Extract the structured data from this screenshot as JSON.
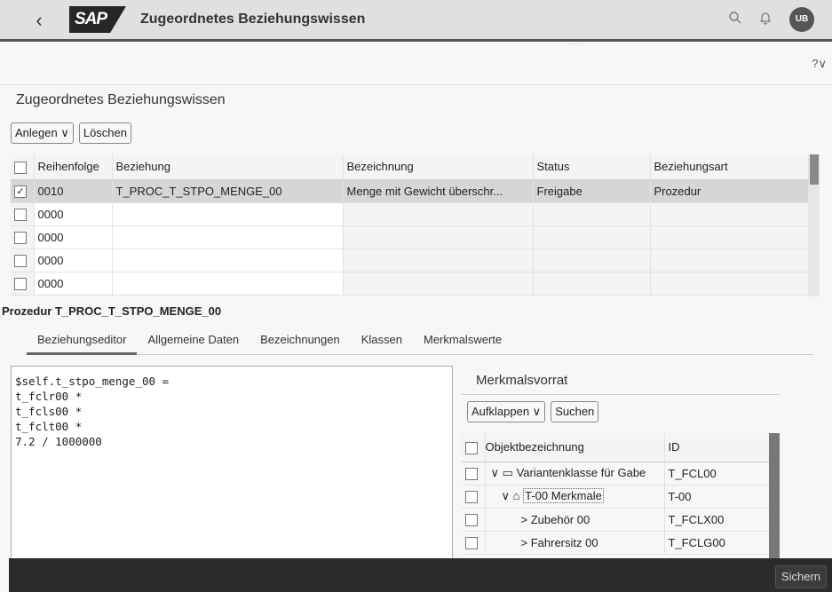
{
  "shell": {
    "logo": "SAP",
    "title": "Zugeordnetes Beziehungswissen",
    "avatar": "UB"
  },
  "help_icon_text": "?∨",
  "section_title": "Zugeordnetes Beziehungswissen",
  "toolbar": {
    "create_label": "Anlegen ∨",
    "delete_label": "Löschen"
  },
  "table": {
    "columns": [
      "Reihenfolge",
      "Beziehung",
      "Bezeichnung",
      "Status",
      "Beziehungsart"
    ],
    "rows": [
      {
        "seq": "0010",
        "relation": "T_PROC_T_STPO_MENGE_00",
        "desc": "Menge mit Gewicht überschr...",
        "status": "Freigabe",
        "type": "Prozedur",
        "checked": true
      },
      {
        "seq": "0000",
        "relation": "",
        "desc": "",
        "status": "",
        "type": "",
        "checked": false
      },
      {
        "seq": "0000",
        "relation": "",
        "desc": "",
        "status": "",
        "type": "",
        "checked": false
      },
      {
        "seq": "0000",
        "relation": "",
        "desc": "",
        "status": "",
        "type": "",
        "checked": false
      },
      {
        "seq": "0000",
        "relation": "",
        "desc": "",
        "status": "",
        "type": "",
        "checked": false
      }
    ]
  },
  "procedure_title": "Prozedur T_PROC_T_STPO_MENGE_00",
  "tabs": [
    "Beziehungseditor",
    "Allgemeine Daten",
    "Bezeichnungen",
    "Klassen",
    "Merkmalswerte"
  ],
  "editor_lines": [
    "$self.t_stpo_menge_00 =",
    "t_fclr00 *",
    "t_fcls00 *",
    "t_fclt00 *",
    "7.2 / 1000000"
  ],
  "panel": {
    "title": "Merkmalsvorrat",
    "expand_label": "Aufklappen ∨",
    "search_label": "Suchen",
    "columns": [
      "Objektbezeichnung",
      "ID"
    ],
    "rows": [
      {
        "indent": 0,
        "arrow": "∨",
        "icon": "▭",
        "name": "Variantenklasse für Gabe",
        "id": "T_FCL00"
      },
      {
        "indent": 1,
        "arrow": "∨",
        "icon": "⌂",
        "name": "T-00 Merkmale",
        "id": "T-00"
      },
      {
        "indent": 2,
        "arrow": ">",
        "icon": "",
        "name": "Zubehör 00",
        "id": "T_FCLX00"
      },
      {
        "indent": 2,
        "arrow": ">",
        "icon": "",
        "name": "Fahrersitz 00",
        "id": "T_FCLG00"
      }
    ]
  },
  "footer": {
    "save_label": "Sichern"
  }
}
